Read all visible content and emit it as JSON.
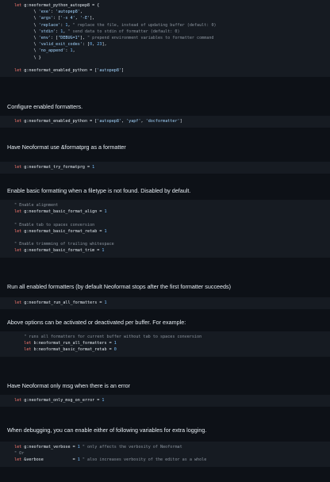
{
  "blocks": [
    {
      "type": "code",
      "lines": [
        [
          {
            "t": "kw",
            "v": "let "
          },
          {
            "t": "plain",
            "v": "g:neoformat_python_autopep8 = {"
          }
        ],
        [
          {
            "t": "plain",
            "v": "        \\ "
          },
          {
            "t": "str",
            "v": "'exe'"
          },
          {
            "t": "plain",
            "v": ": "
          },
          {
            "t": "str",
            "v": "'autopep8'"
          },
          {
            "t": "plain",
            "v": ","
          }
        ],
        [
          {
            "t": "plain",
            "v": "        \\ "
          },
          {
            "t": "str",
            "v": "'args'"
          },
          {
            "t": "plain",
            "v": ": ["
          },
          {
            "t": "str",
            "v": "'-s 4'"
          },
          {
            "t": "plain",
            "v": ", "
          },
          {
            "t": "str",
            "v": "'-E'"
          },
          {
            "t": "plain",
            "v": "],"
          }
        ],
        [
          {
            "t": "plain",
            "v": "        \\ "
          },
          {
            "t": "str",
            "v": "'replace'"
          },
          {
            "t": "plain",
            "v": ": "
          },
          {
            "t": "num",
            "v": "1"
          },
          {
            "t": "plain",
            "v": ", "
          },
          {
            "t": "cmt",
            "v": "\" replace the file, instead of updating buffer (default: 0)"
          }
        ],
        [
          {
            "t": "plain",
            "v": "        \\ "
          },
          {
            "t": "str",
            "v": "'stdin'"
          },
          {
            "t": "plain",
            "v": ": "
          },
          {
            "t": "num",
            "v": "1"
          },
          {
            "t": "plain",
            "v": ", "
          },
          {
            "t": "cmt",
            "v": "\" send data to stdin of formatter (default: 0)"
          }
        ],
        [
          {
            "t": "plain",
            "v": "        \\ "
          },
          {
            "t": "str",
            "v": "'env'"
          },
          {
            "t": "plain",
            "v": ": ["
          },
          {
            "t": "str",
            "v": "\"DEBUG=1\""
          },
          {
            "t": "plain",
            "v": "], "
          },
          {
            "t": "cmt",
            "v": "\" prepend environment variables to formatter command"
          }
        ],
        [
          {
            "t": "plain",
            "v": "        \\ "
          },
          {
            "t": "str",
            "v": "'valid_exit_codes'"
          },
          {
            "t": "plain",
            "v": ": ["
          },
          {
            "t": "num",
            "v": "0"
          },
          {
            "t": "plain",
            "v": ", "
          },
          {
            "t": "num",
            "v": "23"
          },
          {
            "t": "plain",
            "v": "],"
          }
        ],
        [
          {
            "t": "plain",
            "v": "        \\ "
          },
          {
            "t": "str",
            "v": "'no_append'"
          },
          {
            "t": "plain",
            "v": ": "
          },
          {
            "t": "num",
            "v": "1"
          },
          {
            "t": "plain",
            "v": ","
          }
        ],
        [
          {
            "t": "plain",
            "v": "        \\ }"
          }
        ],
        [
          {
            "t": "plain",
            "v": ""
          }
        ],
        [
          {
            "t": "kw",
            "v": "let "
          },
          {
            "t": "plain",
            "v": "g:neoformat_enabled_python = ["
          },
          {
            "t": "str",
            "v": "'autopep8'"
          },
          {
            "t": "plain",
            "v": "]"
          }
        ]
      ]
    },
    {
      "type": "para",
      "text": "Configure enabled formatters."
    },
    {
      "type": "code",
      "lines": [
        [
          {
            "t": "kw",
            "v": "let "
          },
          {
            "t": "plain",
            "v": "g:neoformat_enabled_python = ["
          },
          {
            "t": "str",
            "v": "'autopep8'"
          },
          {
            "t": "plain",
            "v": ", "
          },
          {
            "t": "str",
            "v": "'yapf'"
          },
          {
            "t": "plain",
            "v": ", "
          },
          {
            "t": "str",
            "v": "'docformatter'"
          },
          {
            "t": "plain",
            "v": "]"
          }
        ]
      ]
    },
    {
      "type": "para",
      "text": "Have Neoformat use &formatprg as a formatter"
    },
    {
      "type": "code",
      "lines": [
        [
          {
            "t": "kw",
            "v": "let "
          },
          {
            "t": "plain",
            "v": "g:neoformat_try_formatprg = "
          },
          {
            "t": "num",
            "v": "1"
          }
        ]
      ]
    },
    {
      "type": "para",
      "text": "Enable basic formatting when a filetype is not found. Disabled by default."
    },
    {
      "type": "code",
      "lines": [
        [
          {
            "t": "cmt",
            "v": "\" Enable alignment"
          }
        ],
        [
          {
            "t": "kw",
            "v": "let "
          },
          {
            "t": "plain",
            "v": "g:neoformat_basic_format_align = "
          },
          {
            "t": "num",
            "v": "1"
          }
        ],
        [
          {
            "t": "plain",
            "v": ""
          }
        ],
        [
          {
            "t": "cmt",
            "v": "\" Enable tab to spaces conversion"
          }
        ],
        [
          {
            "t": "kw",
            "v": "let "
          },
          {
            "t": "plain",
            "v": "g:neoformat_basic_format_retab = "
          },
          {
            "t": "num",
            "v": "1"
          }
        ],
        [
          {
            "t": "plain",
            "v": ""
          }
        ],
        [
          {
            "t": "cmt",
            "v": "\" Enable trimmming of trailing whitespace"
          }
        ],
        [
          {
            "t": "kw",
            "v": "let "
          },
          {
            "t": "plain",
            "v": "g:neoformat_basic_format_trim = "
          },
          {
            "t": "num",
            "v": "1"
          }
        ]
      ]
    },
    {
      "type": "para",
      "text": "Run all enabled formatters (by default Neoformat stops after the first formatter succeeds)"
    },
    {
      "type": "code",
      "lines": [
        [
          {
            "t": "kw",
            "v": "let "
          },
          {
            "t": "plain",
            "v": "g:neoformat_run_all_formatters = "
          },
          {
            "t": "num",
            "v": "1"
          }
        ]
      ]
    },
    {
      "type": "para",
      "text": "Above options can be activated or deactivated per buffer. For example:"
    },
    {
      "type": "code",
      "lines": [
        [
          {
            "t": "cmt",
            "v": "    \" runs all formatters for current buffer without tab to spaces conversion"
          }
        ],
        [
          {
            "t": "plain",
            "v": "    "
          },
          {
            "t": "kw",
            "v": "let "
          },
          {
            "t": "plain",
            "v": "b:neoformat_run_all_formatters = "
          },
          {
            "t": "num",
            "v": "1"
          }
        ],
        [
          {
            "t": "plain",
            "v": "    "
          },
          {
            "t": "kw",
            "v": "let "
          },
          {
            "t": "plain",
            "v": "b:neoformat_basic_format_retab = "
          },
          {
            "t": "num",
            "v": "0"
          }
        ]
      ]
    },
    {
      "type": "para",
      "text": "Have Neoformat only msg when there is an error"
    },
    {
      "type": "code",
      "lines": [
        [
          {
            "t": "kw",
            "v": "let "
          },
          {
            "t": "plain",
            "v": "g:neoformat_only_msg_on_error = "
          },
          {
            "t": "num",
            "v": "1"
          }
        ]
      ]
    },
    {
      "type": "para",
      "text": "When debugging, you can enable either of following variables for extra logging."
    },
    {
      "type": "code",
      "lines": [
        [
          {
            "t": "kw",
            "v": "let "
          },
          {
            "t": "plain",
            "v": "g:neoformat_verbose = "
          },
          {
            "t": "num",
            "v": "1"
          },
          {
            "t": "plain",
            "v": " "
          },
          {
            "t": "cmt",
            "v": "\" only affects the verbosity of Neoformat"
          }
        ],
        [
          {
            "t": "cmt",
            "v": "\" Or"
          }
        ],
        [
          {
            "t": "kw",
            "v": "let "
          },
          {
            "t": "plain",
            "v": "&verbose            = "
          },
          {
            "t": "num",
            "v": "1"
          },
          {
            "t": "plain",
            "v": " "
          },
          {
            "t": "cmt",
            "v": "\" also increases verbosity of the editor as a whole"
          }
        ]
      ]
    }
  ]
}
